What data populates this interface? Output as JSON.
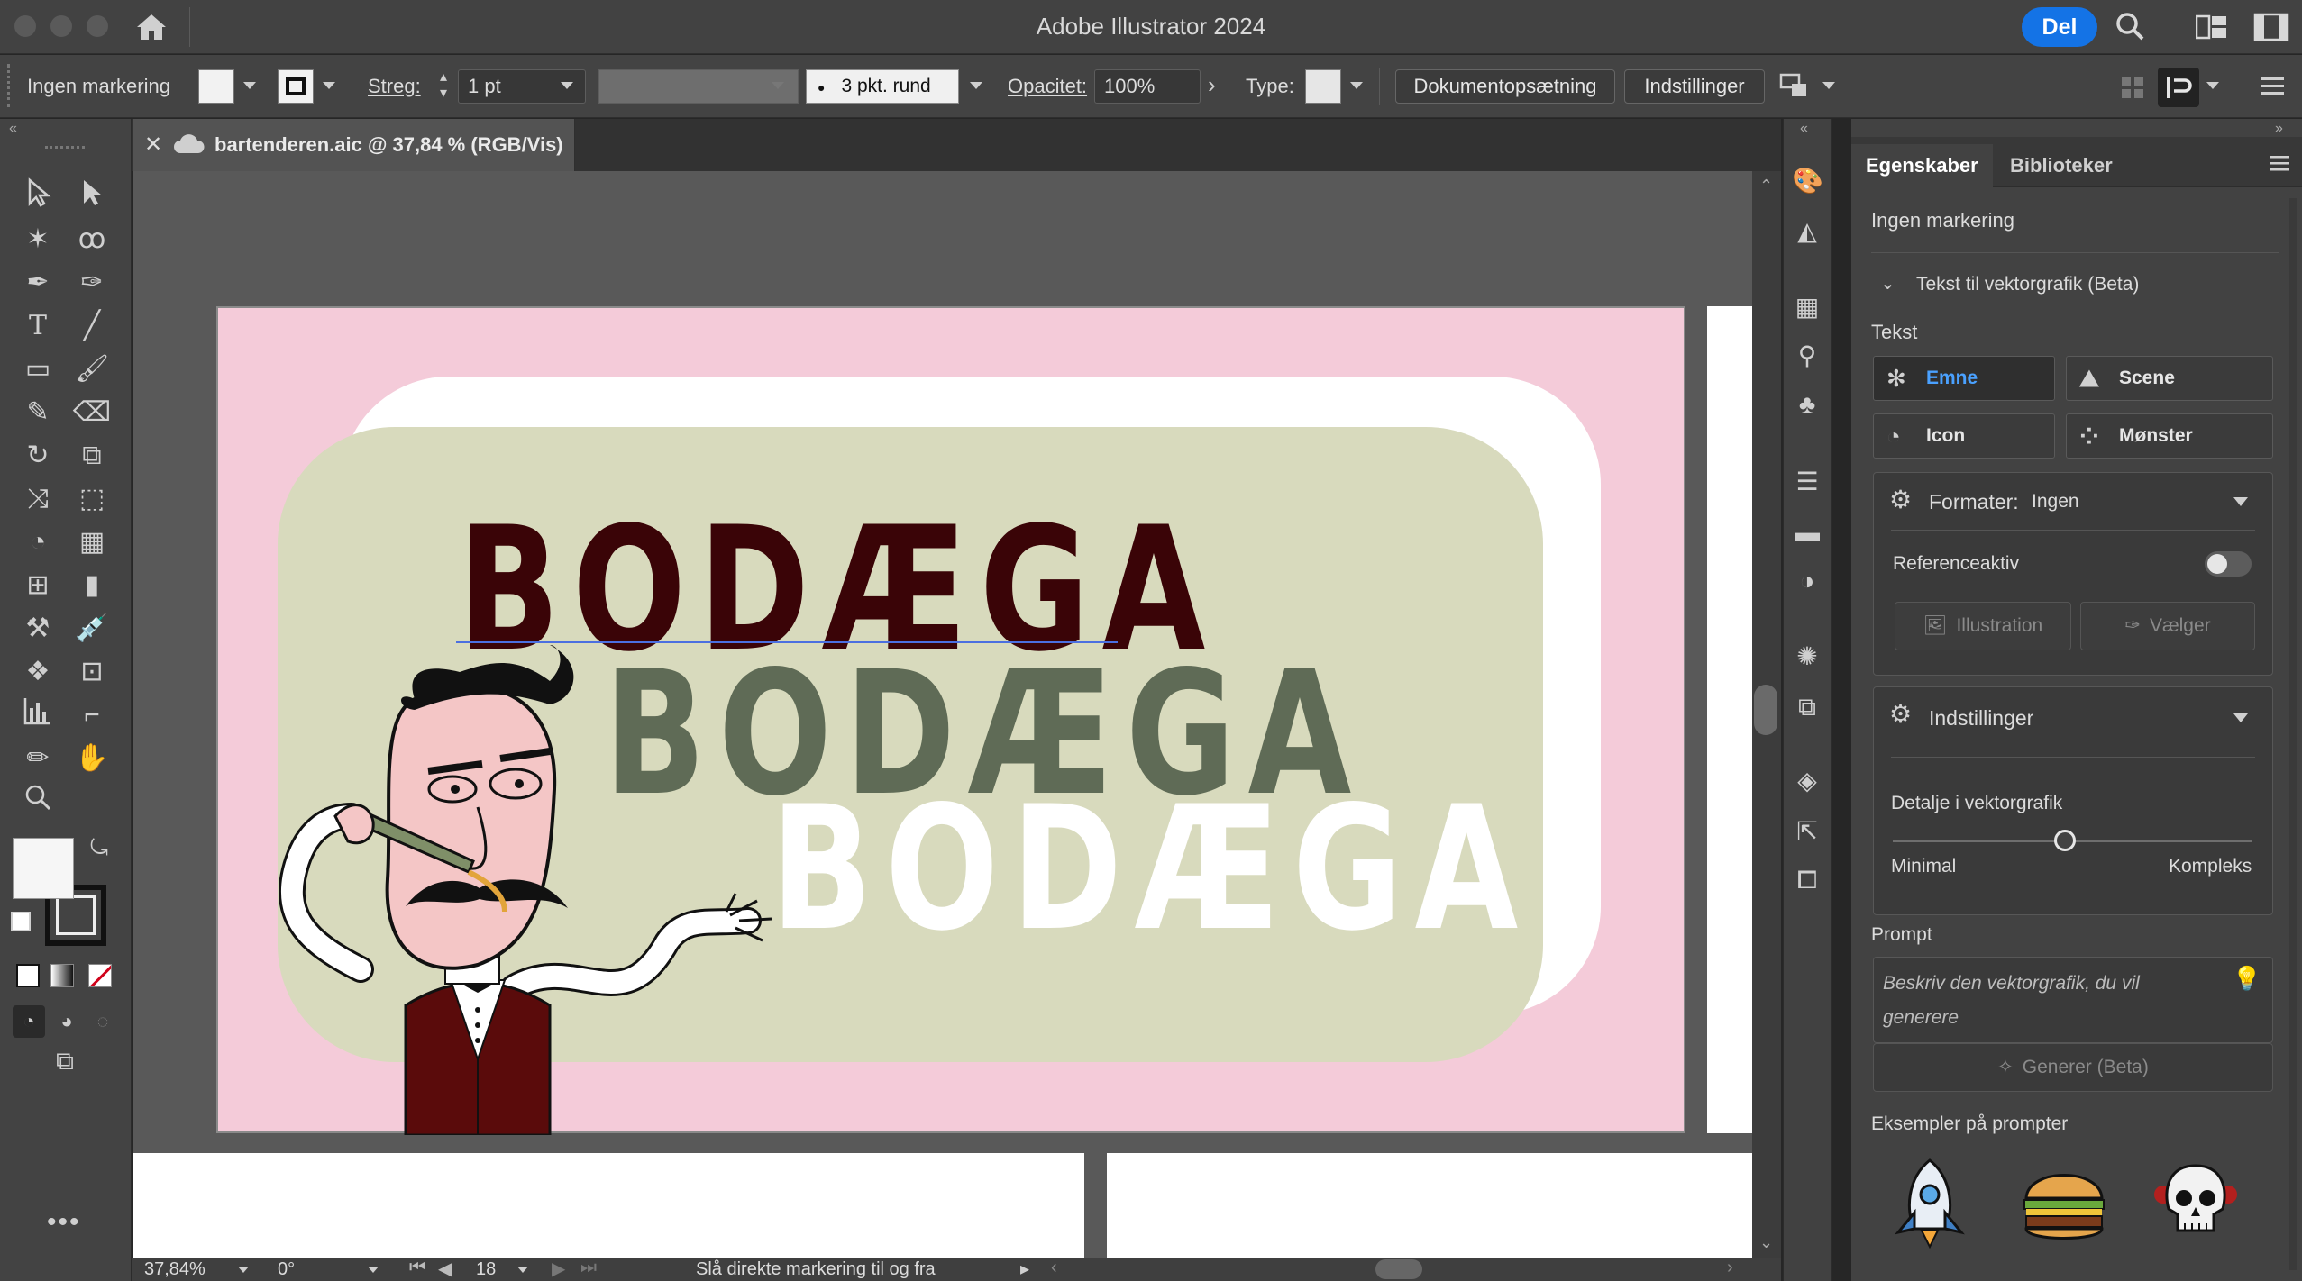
{
  "window": {
    "title": "Adobe Illustrator 2024",
    "share_label": "Del"
  },
  "control_bar": {
    "selection": "Ingen markering",
    "stroke_label": "Streg:",
    "stroke_value": "1 pt",
    "brush_value": "3 pkt. rund",
    "opacity_label": "Opacitet:",
    "opacity_value": "100%",
    "type_label": "Type:",
    "doc_setup_label": "Dokumentopsætning",
    "settings_label": "Indstillinger"
  },
  "document": {
    "tab_title": "bartenderen.aic @ 37,84 % (RGB/Vis)"
  },
  "artwork": {
    "word1": "BODÆGA",
    "word2": "BODÆGA",
    "word3": "BODÆGA",
    "colors": {
      "background": "#f4cbd9",
      "card": "#d8dabd",
      "word1": "#3a0407",
      "word2": "#5f6b56",
      "word3": "#ffffff"
    }
  },
  "status_bar": {
    "zoom": "37,84%",
    "rotation": "0°",
    "artboard_number": "18",
    "hint": "Slå direkte markering til og fra"
  },
  "properties_panel": {
    "tabs": [
      "Egenskaber",
      "Biblioteker"
    ],
    "selection_status": "Ingen markering",
    "section_title": "Tekst til vektorgrafik (Beta)",
    "text_label": "Tekst",
    "types": {
      "subject": "Emne",
      "scene": "Scene",
      "icon": "Icon",
      "pattern": "Mønster"
    },
    "format_label": "Formater:",
    "format_value": "Ingen",
    "reference_label": "Referenceaktiv",
    "illustration_label": "Illustration",
    "picker_label": "Vælger",
    "settings_label": "Indstillinger",
    "detail_label": "Detalje i vektorgrafik",
    "min_label": "Minimal",
    "max_label": "Kompleks",
    "detail_level": 0.48,
    "prompt_label": "Prompt",
    "prompt_placeholder": "Beskriv den vektorgrafik, du vil generere",
    "generate_label": "Generer (Beta)",
    "examples_label": "Eksempler på prompter",
    "example_icons": [
      "rocket-icon",
      "burger-icon",
      "skull-icon"
    ]
  }
}
